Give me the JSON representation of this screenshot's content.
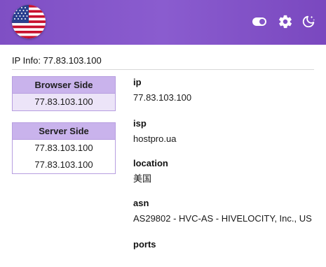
{
  "header": {
    "flag_icon": "us-flag-icon",
    "icons": [
      "toggle-icon",
      "gear-icon",
      "moon-stars-icon"
    ],
    "accent": "#8556c9"
  },
  "ip_info": {
    "text": "IP Info: 77.83.103.100"
  },
  "browser_side": {
    "title": "Browser Side",
    "ips": [
      "77.83.103.100"
    ]
  },
  "server_side": {
    "title": "Server Side",
    "ips": [
      "77.83.103.100",
      "77.83.103.100"
    ]
  },
  "details": [
    {
      "label": "ip",
      "value": "77.83.103.100"
    },
    {
      "label": "isp",
      "value": "hostpro.ua"
    },
    {
      "label": "location",
      "value": "美国"
    },
    {
      "label": "asn",
      "value": "AS29802 - HVC-AS - HIVELOCITY, Inc., US"
    },
    {
      "label": "ports",
      "value": ""
    }
  ]
}
